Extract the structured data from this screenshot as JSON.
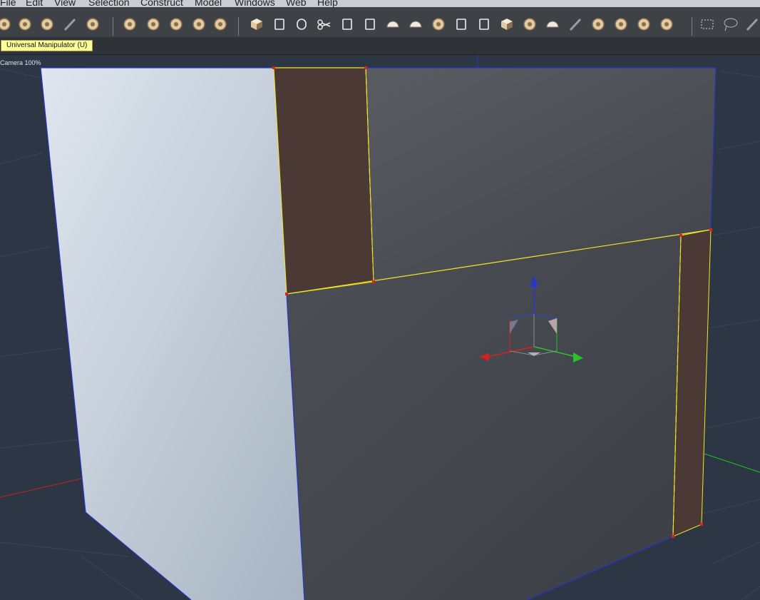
{
  "menu": {
    "items": [
      "File",
      "Edit",
      "View",
      "Selection",
      "Construct",
      "Model",
      "Windows",
      "Web",
      "Help"
    ]
  },
  "toolbar": {
    "tools": [
      "paint-icon",
      "rotate-icon",
      "swirl-icon",
      "wand-icon",
      "lasso-tool-icon",
      "move-icon",
      "move-multi-icon",
      "move-plane-icon",
      "universal-manipulator-icon",
      "plane-icon",
      "cube-icon",
      "spline-icon",
      "magnet-icon",
      "scissors-icon",
      "knife-icon",
      "bevel-icon",
      "dome-icon",
      "lathe-icon",
      "extrude-icon",
      "goblet-icon",
      "frame-icon",
      "box-icon",
      "bag-icon",
      "bowl-icon",
      "brush-icon",
      "morph-icon",
      "fold-icon",
      "slice-icon",
      "weld-icon",
      "rect-select-icon",
      "lasso-select-icon",
      "pen-icon"
    ]
  },
  "tooltip": {
    "text": "Universal Manipulator (U)"
  },
  "viewport": {
    "camera_label": "Camera 100%"
  },
  "colors": {
    "selected_edge": "#f5e623",
    "edge": "#2234c8",
    "selected_face": "#4a3934",
    "axis_x": "#d4221c",
    "axis_y": "#2bc12b",
    "axis_z": "#2a36c8"
  }
}
